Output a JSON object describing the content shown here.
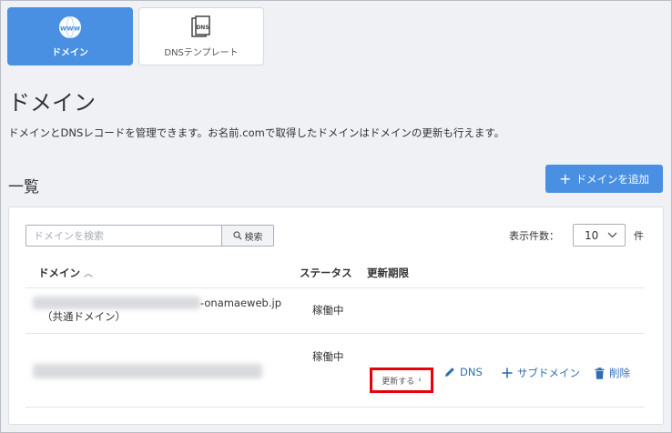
{
  "tabs": [
    {
      "label": "ドメイン",
      "icon": "globe-www-icon",
      "active": true
    },
    {
      "label": "DNSテンプレート",
      "icon": "dns-template-icon",
      "active": false
    }
  ],
  "page": {
    "title": "ドメイン",
    "description": "ドメインとDNSレコードを管理できます。お名前.comで取得したドメインはドメインの更新も行えます。"
  },
  "section": {
    "title": "一覧",
    "add_button": "ドメインを追加"
  },
  "search": {
    "placeholder": "ドメインを検索",
    "button": "検索"
  },
  "paging": {
    "label": "表示件数：",
    "value": "10",
    "unit": "件"
  },
  "table": {
    "headers": [
      "ドメイン",
      "ステータス",
      "更新期限"
    ],
    "rows": [
      {
        "domain_suffix": "-onamaeweb.jp",
        "domain_note": "（共通ドメイン）",
        "status": "稼働中"
      },
      {
        "status": "稼働中"
      }
    ]
  },
  "actions": {
    "renew": "更新する",
    "dns": "DNS",
    "subdomain": "サブドメイン",
    "delete": "削除"
  },
  "colors": {
    "accent": "#4a90e2",
    "link": "#2f6db5",
    "highlight": "#e8000b"
  }
}
